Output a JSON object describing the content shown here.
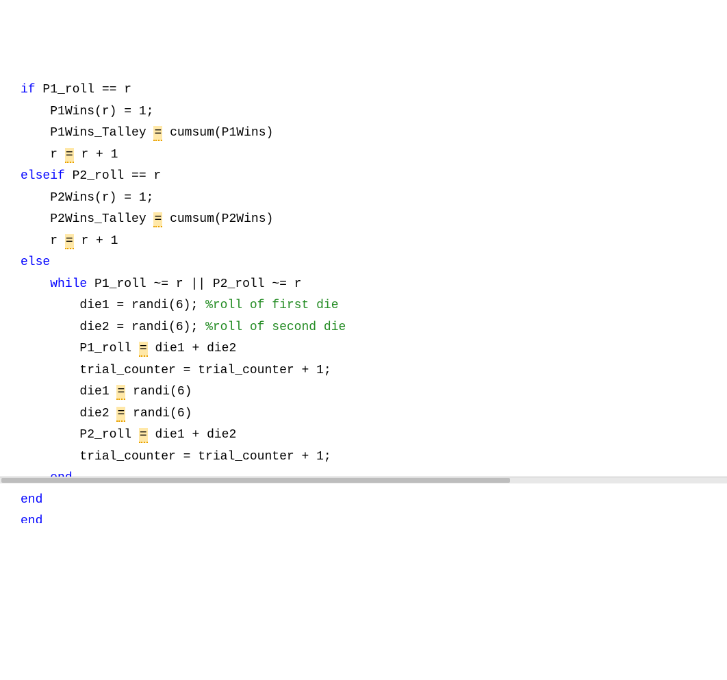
{
  "code": {
    "lines": [
      {
        "indent": 0,
        "segments": [
          {
            "type": "keyword",
            "text": "if"
          },
          {
            "type": "plain",
            "text": " P1_roll == r"
          }
        ],
        "cut": "top"
      },
      {
        "indent": 1,
        "segments": [
          {
            "type": "plain",
            "text": "P1Wins(r) = 1;"
          }
        ]
      },
      {
        "indent": 1,
        "segments": [
          {
            "type": "plain",
            "text": "P1Wins_Talley "
          },
          {
            "type": "warn",
            "text": "="
          },
          {
            "type": "plain",
            "text": " cumsum(P1Wins)"
          }
        ]
      },
      {
        "indent": 1,
        "segments": [
          {
            "type": "plain",
            "text": "r "
          },
          {
            "type": "warn",
            "text": "="
          },
          {
            "type": "plain",
            "text": " r + 1"
          }
        ]
      },
      {
        "indent": 0,
        "segments": [
          {
            "type": "keyword",
            "text": "elseif"
          },
          {
            "type": "plain",
            "text": " P2_roll == r"
          }
        ]
      },
      {
        "indent": 1,
        "segments": [
          {
            "type": "plain",
            "text": "P2Wins(r) = 1;"
          }
        ]
      },
      {
        "indent": 1,
        "segments": [
          {
            "type": "plain",
            "text": "P2Wins_Talley "
          },
          {
            "type": "warn",
            "text": "="
          },
          {
            "type": "plain",
            "text": " cumsum(P2Wins)"
          }
        ]
      },
      {
        "indent": 1,
        "segments": [
          {
            "type": "plain",
            "text": "r "
          },
          {
            "type": "warn",
            "text": "="
          },
          {
            "type": "plain",
            "text": " r + 1"
          }
        ]
      },
      {
        "indent": 0,
        "segments": [
          {
            "type": "keyword",
            "text": "else"
          }
        ]
      },
      {
        "indent": 1,
        "segments": [
          {
            "type": "keyword",
            "text": "while"
          },
          {
            "type": "plain",
            "text": " P1_roll ~= r || P2_roll ~= r"
          }
        ]
      },
      {
        "indent": 2,
        "segments": [
          {
            "type": "plain",
            "text": "die1 = randi(6); "
          },
          {
            "type": "comment",
            "text": "%roll of first die"
          }
        ]
      },
      {
        "indent": 2,
        "segments": [
          {
            "type": "plain",
            "text": "die2 = randi(6); "
          },
          {
            "type": "comment",
            "text": "%roll of second die"
          }
        ]
      },
      {
        "indent": 2,
        "segments": [
          {
            "type": "plain",
            "text": "P1_roll "
          },
          {
            "type": "warn",
            "text": "="
          },
          {
            "type": "plain",
            "text": " die1 + die2"
          }
        ]
      },
      {
        "indent": 2,
        "segments": [
          {
            "type": "plain",
            "text": "trial_counter = trial_counter + 1;"
          }
        ]
      },
      {
        "indent": 2,
        "segments": [
          {
            "type": "plain",
            "text": "die1 "
          },
          {
            "type": "warn",
            "text": "="
          },
          {
            "type": "plain",
            "text": " randi(6)"
          }
        ]
      },
      {
        "indent": 2,
        "segments": [
          {
            "type": "plain",
            "text": "die2 "
          },
          {
            "type": "warn",
            "text": "="
          },
          {
            "type": "plain",
            "text": " randi(6)"
          }
        ]
      },
      {
        "indent": 2,
        "segments": [
          {
            "type": "plain",
            "text": "P2_roll "
          },
          {
            "type": "warn",
            "text": "="
          },
          {
            "type": "plain",
            "text": " die1 + die2"
          }
        ]
      },
      {
        "indent": 2,
        "segments": [
          {
            "type": "plain",
            "text": "trial_counter = trial_counter + 1;"
          }
        ]
      },
      {
        "indent": 1,
        "segments": [
          {
            "type": "keyword",
            "text": "end"
          }
        ]
      },
      {
        "indent": 0,
        "segments": [
          {
            "type": "keyword",
            "text": "end"
          }
        ]
      },
      {
        "indent": 0,
        "segments": [
          {
            "type": "keyword",
            "text": "end"
          }
        ],
        "cut": "bottom"
      }
    ]
  },
  "indent_unit": "    "
}
